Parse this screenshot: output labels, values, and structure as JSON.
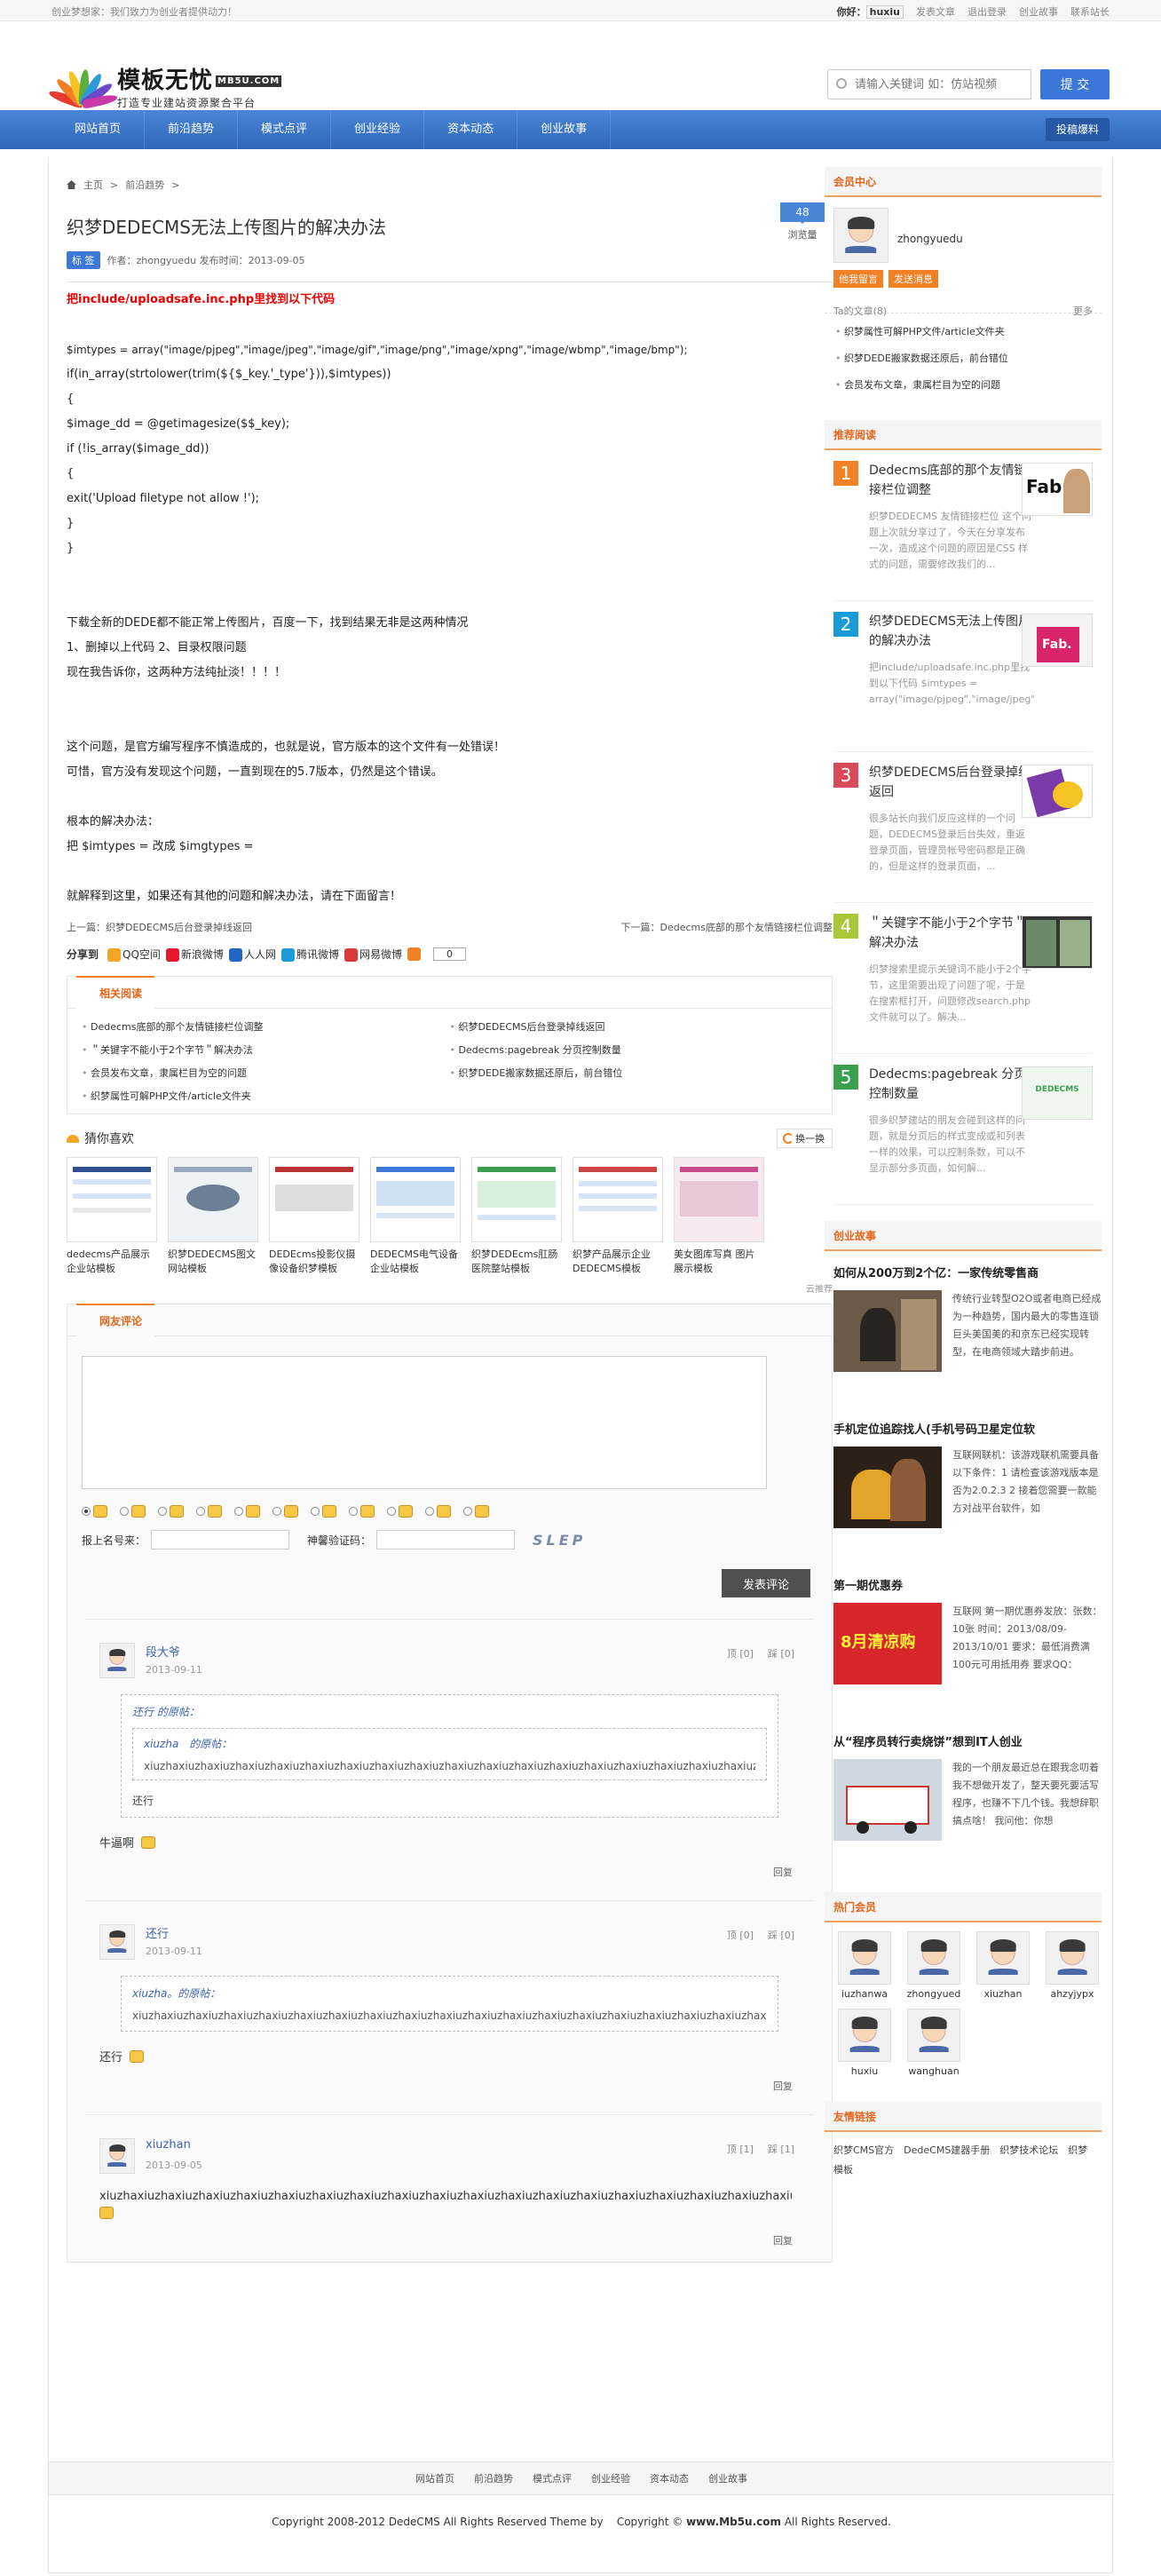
{
  "topbar": {
    "slogan": "创业梦想家：我们致力为创业者提供动力！",
    "hello": "你好：",
    "user": "huxiu",
    "post": "发表文章",
    "logout": "退出登录",
    "story": "创业故事",
    "contact": "联系站长"
  },
  "logo": {
    "title": "模板无忧",
    "badge": "MB5U.COM",
    "sub": "打造专业建站资源聚合平台"
  },
  "search": {
    "placeholder": "请输入关键词 如：仿站视频",
    "button": "提 交"
  },
  "nav": {
    "items": [
      "网站首页",
      "前沿趋势",
      "模式点评",
      "创业经验",
      "资本动态",
      "创业故事"
    ],
    "tip": "投稿爆料"
  },
  "crumb": {
    "home": "主页",
    "sep1": ">",
    "section": "前沿趋势",
    "sep2": ">"
  },
  "article": {
    "title": "织梦DEDECMS无法上传图片的解决办法",
    "views": "48",
    "views_label": "浏览量",
    "tag": "标 签",
    "meta": "作者：zhongyuedu 发布时间：2013-09-05",
    "lines": [
      "把include/uploadsafe.inc.php里找到以下代码",
      "",
      "$imtypes = array(\"image/pjpeg\",\"image/jpeg\",\"image/gif\",\"image/png\",\"image/xpng\",\"image/wbmp\",\"image/bmp\");",
      "if(in_array(strtolower(trim(${$_key.'_type'})),$imtypes))",
      "{",
      "$image_dd = @getimagesize($$_key);",
      "if (!is_array($image_dd))",
      "{",
      "exit('Upload filetype not allow !');",
      "}",
      "}",
      "",
      "",
      "下载全新的DEDE都不能正常上传图片，百度一下，找到结果无非是这两种情况",
      "1、删掉以上代码 2、目录权限问题",
      "现在我告诉你，这两种方法纯扯淡！！！！",
      "",
      "",
      "这个问题，是官方编写程序不慎造成的，也就是说，官方版本的这个文件有一处错误！",
      "可惜，官方没有发现这个问题，一直到现在的5.7版本，仍然是这个错误。",
      "",
      "根本的解决办法：",
      "把 $imtypes = 改成 $imgtypes =",
      "",
      "就解释到这里，如果还有其他的问题和解决办法，请在下面留言！"
    ],
    "prev": "上一篇：织梦DEDECMS后台登录掉线返回",
    "next": "下一篇：Dedecms底部的那个友情链接栏位调整"
  },
  "share": {
    "label": "分享到",
    "items": [
      {
        "name": "QQ空间",
        "color": "#f5a524"
      },
      {
        "name": "新浪微博",
        "color": "#e6162d"
      },
      {
        "name": "人人网",
        "color": "#2266c2"
      },
      {
        "name": "腾讯微博",
        "color": "#1a9bd7"
      },
      {
        "name": "网易微博",
        "color": "#d83a3a"
      }
    ],
    "count": "0"
  },
  "related": {
    "title": "相关阅读",
    "items": [
      "Dedecms底部的那个友情链接栏位调整",
      "织梦DEDECMS后台登录掉线返回",
      "＂关键字不能小于2个字节＂解决办法",
      "Dedecms:pagebreak 分页控制数量",
      "会员发布文章，隶属栏目为空的问题",
      "织梦DEDE搬家数据还原后，前台错位",
      "织梦属性可解PHP文件/article文件夹"
    ]
  },
  "guess": {
    "title": "猜你喜欢",
    "switch": "换一换",
    "items": [
      "dedecms产品展示企业站模板",
      "织梦DEDECMS图文网站模板",
      "DEDEcms投影仪摄像设备织梦模板",
      "DEDECMS电气设备企业站模板",
      "织梦DEDEcms肛肠医院整站模板",
      "织梦产品展示企业DEDECMS模板",
      "美女图库写真 图片展示模板"
    ],
    "credit": "云推荐"
  },
  "comment": {
    "title": "网友评论",
    "name_label": "报上名号来：",
    "code_label": "神馨验证码：",
    "captcha": "SLEP",
    "submit": "发表评论",
    "list": [
      {
        "name": "段大爷",
        "date": "2013-09-11",
        "up": "顶 [0]",
        "down": "踩 [0]",
        "quote_by": "还行 的原帖：",
        "inner_by": "xiuzha　的原帖：",
        "inner_text": "xiuzhaxiuzhaxiuzhaxiuzhaxiuzhaxiuzhaxiuzhaxiuzhaxiuzhaxiuzhaxiuzhaxiuzhaxiuzhaxiuzhaxiuzhaxiuzhaxiuzhaxiuzhaxiuzhaxiuzhaxiuzhaxiuzhaxiuzhaxiuzhaxiuzha",
        "quote_text": "还行",
        "text": "牛逼啊",
        "reply": "回复"
      },
      {
        "name": "还行",
        "date": "2013-09-11",
        "up": "顶 [0]",
        "down": "踩 [0]",
        "quote_by": "xiuzha。的原帖：",
        "quote_text": "xiuzhaxiuzhaxiuzhaxiuzhaxiuzhaxiuzhaxiuzhaxiuzhaxiuzhaxiuzhaxiuzhaxiuzhaxiuzhaxiuzhaxiuzhaxiuzhaxiuzhaxiuzhaxiuzhaxiuzhaxiuzha",
        "text": "还行",
        "reply": "回复"
      },
      {
        "name": "xiuzhan",
        "date": "2013-09-05",
        "up": "顶 [1]",
        "down": "踩 [1]",
        "text": "xiuzhaxiuzhaxiuzhaxiuzhaxiuzhaxiuzhaxiuzhaxiuzhaxiuzhaxiuzhaxiuzhaxiuzhaxiuzhaxiuzhaxiuzhaxiuzhaxiuzhaxiuzhaxiuzha",
        "reply": "回复"
      }
    ]
  },
  "member": {
    "title": "会员中心",
    "name": "zhongyuedu",
    "btn1": "他我留言",
    "btn2": "发送消息",
    "posts": "Ta的文章(8)",
    "more": "更多",
    "items": [
      "织梦属性可解PHP文件/article文件夹",
      "织梦DEDE搬家数据还原后，前台错位",
      "会员发布文章，隶属栏目为空的问题"
    ]
  },
  "recommend": {
    "title": "推荐阅读",
    "items": [
      {
        "num": "1",
        "color": "#f28024",
        "title": "Dedecms底部的那个友情链接栏位调整",
        "desc": "织梦DEDECMS 友情链接栏位 这个问题上次就分享过了，今天在分享发布一次，造成这个问题的原因是CSS 样式的问题，需要修改我们的..."
      },
      {
        "num": "2",
        "color": "#1a9bd7",
        "title": "织梦DEDECMS无法上传图片的解决办法",
        "desc": "把include/uploadsafe.inc.php里找到以下代码 $imtypes = array(\"image/pjpeg\",\"image/jpeg\",\"image/gif\",\"image..."
      },
      {
        "num": "3",
        "color": "#d84a5a",
        "title": "织梦DEDECMS后台登录掉线返回",
        "desc": "很多站长向我们反应这样的一个问题，DEDECMS登录后台失效，重返登录页面，管理员帐号密码都是正确的，但是这样的登录页面，..."
      },
      {
        "num": "4",
        "color": "#a8c83a",
        "title": "＂关键字不能小于2个字节＂解决办法",
        "desc": "织梦搜索里提示关键词不能小于2个字节，这里需要出现了问题了呢，于是在搜索框打开，问题修改search.php文件就可以了。解决..."
      },
      {
        "num": "5",
        "color": "#3aa050",
        "title": "Dedecms:pagebreak 分页控制数量",
        "desc": "很多织梦建站的朋友会碰到这样的问题，就是分页后的样式变成或和列表一样的效果，可以控制条数，可以不显示部分多页面，如何解..."
      }
    ]
  },
  "story": {
    "title": "创业故事",
    "items": [
      {
        "title": "如何从200万到2个亿：一家传统零售商",
        "desc": "传统行业转型O2O或者电商已经成为一种趋势，国内最大的零售连锁巨头美国美的和京东已经实现转型，在电商领域大踏步前进。"
      },
      {
        "title": "手机定位追踪找人(手机号码卫星定位软",
        "desc": "互联网联机：该游戏联机需要具备以下条件：1 请检查该游戏版本是否为2.0.2.3 2 接着您需要一款能方对战平台软件，如"
      },
      {
        "title": "第一期优惠券",
        "desc": "互联网 第一期优惠券发放：张数：10张 时间：2013/08/09-2013/10/01 要求：最低消费满100元可用抵用券 要求QQ：",
        "promo": "8月清凉购"
      },
      {
        "title": "从“程序员转行卖烧饼”想到IT人创业",
        "desc": "我的一个朋友最近总在跟我念叨着我不想做开发了，整天要死要活写程序，也赚不下几个钱。我想辞职搞点啥！ 我问他：你想"
      }
    ]
  },
  "hot": {
    "title": "热门会员",
    "names": [
      "iuzhanwa",
      "zhongyued",
      "xiuzhan",
      "ahzyjypx",
      "huxiu",
      "wanghuan"
    ]
  },
  "links": {
    "title": "友情链接",
    "text": "织梦CMS官方　DedeCMS建器手册　织梦技术论坛　织梦模板"
  },
  "footer": {
    "nav": [
      "网站首页",
      "前沿趋势",
      "模式点评",
      "创业经验",
      "资本动态",
      "创业故事"
    ],
    "copy1": "Copyright 2008-2012 DedeCMS All Rights Reserved Theme by",
    "copy2": "Copyright ©",
    "site": "www.Mb5u.com",
    "copy3": "All Rights Reserved."
  }
}
